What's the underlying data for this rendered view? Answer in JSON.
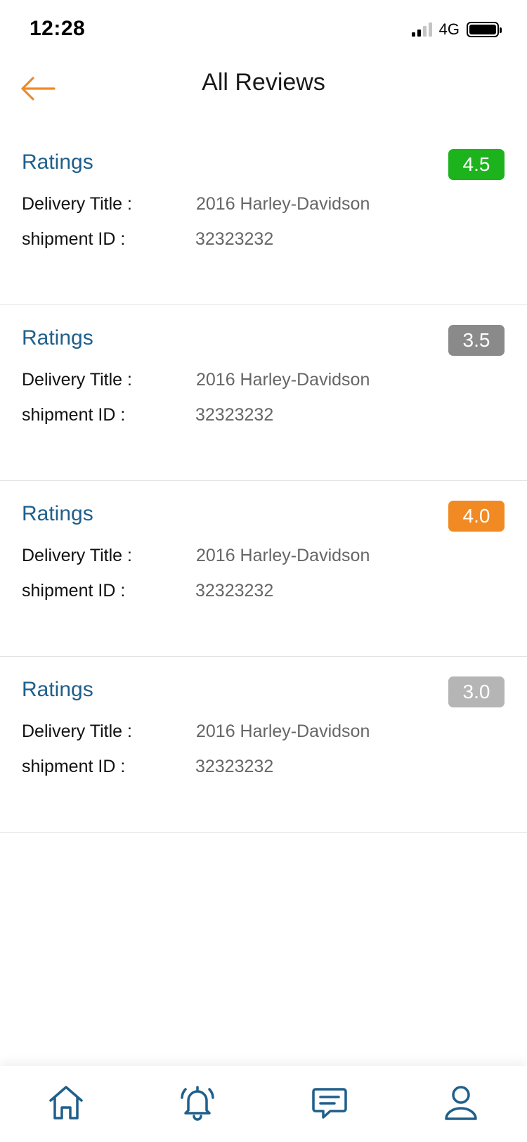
{
  "status_bar": {
    "time": "12:28",
    "network": "4G"
  },
  "header": {
    "title": "All Reviews"
  },
  "reviews": [
    {
      "label": "Ratings",
      "rating": "4.5",
      "rating_color": "#1db31d",
      "delivery_label": "Delivery Title :",
      "delivery_title": "2016 Harley-Davidson",
      "shipment_label": "shipment ID :",
      "shipment_id": "32323232"
    },
    {
      "label": "Ratings",
      "rating": "3.5",
      "rating_color": "#8a8a8a",
      "delivery_label": "Delivery Title :",
      "delivery_title": "2016 Harley-Davidson",
      "shipment_label": "shipment ID :",
      "shipment_id": "32323232"
    },
    {
      "label": "Ratings",
      "rating": "4.0",
      "rating_color": "#f28a23",
      "delivery_label": "Delivery Title :",
      "delivery_title": "2016 Harley-Davidson",
      "shipment_label": "shipment ID :",
      "shipment_id": "32323232"
    },
    {
      "label": "Ratings",
      "rating": "3.0",
      "rating_color": "#b5b5b5",
      "delivery_label": "Delivery Title :",
      "delivery_title": "2016 Harley-Davidson",
      "shipment_label": "shipment ID :",
      "shipment_id": "32323232"
    }
  ],
  "bottom_nav": [
    {
      "icon": "home-icon"
    },
    {
      "icon": "bell-icon"
    },
    {
      "icon": "chat-icon"
    },
    {
      "icon": "profile-icon"
    }
  ],
  "colors": {
    "accent": "#f28a23",
    "primary": "#1f5f8b"
  }
}
